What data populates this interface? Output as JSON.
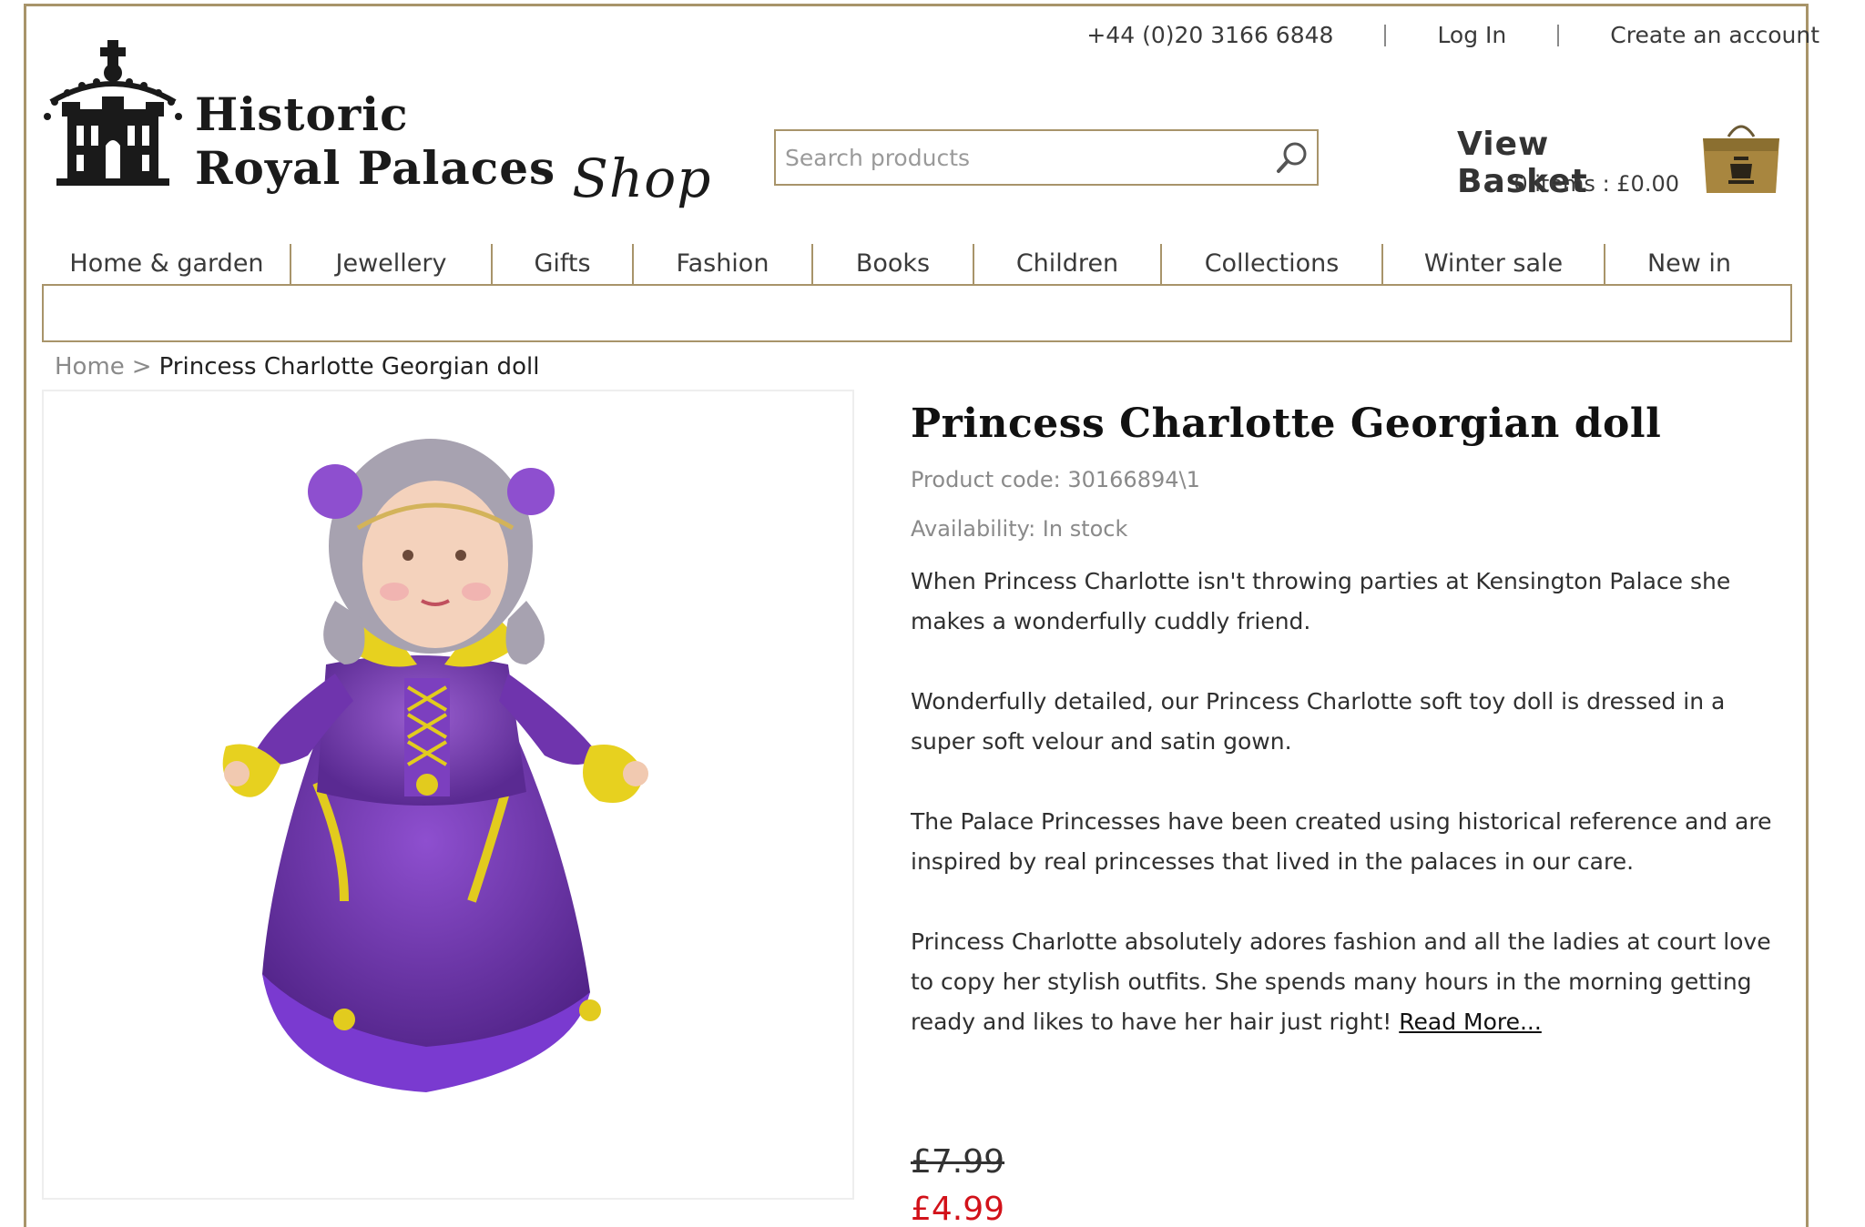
{
  "header": {
    "phone": "+44 (0)20 3166 6848",
    "login": "Log In",
    "create_account": "Create an account",
    "logo_line1": "Historic",
    "logo_line2": "Royal Palaces",
    "logo_shop": "Shop"
  },
  "search": {
    "placeholder": "Search products"
  },
  "basket": {
    "title": "View Basket",
    "summary": "0 items : £0.00"
  },
  "nav": {
    "items": [
      "Home & garden",
      "Jewellery",
      "Gifts",
      "Fashion",
      "Books",
      "Children",
      "Collections",
      "Winter sale",
      "New in"
    ]
  },
  "breadcrumb": {
    "home": "Home",
    "separator": ">",
    "current": "Princess Charlotte Georgian doll"
  },
  "product": {
    "title": "Princess Charlotte Georgian doll",
    "code": "Product code: 30166894\\1",
    "availability": "Availability: In stock",
    "description": [
      "When Princess Charlotte isn't throwing parties at Kensington Palace she makes a wonderfully cuddly friend.",
      "Wonderfully detailed, our Princess Charlotte soft toy doll is dressed in a super soft velour and satin gown.",
      "The Palace Princesses have been created using historical reference and are inspired by real princesses that lived in the palaces in our care.",
      "Princess Charlotte absolutely adores fashion and all the ladies at court love to copy her stylish outfits. She spends many hours in the morning getting ready and likes to have her hair just right!"
    ],
    "read_more": "Read More...",
    "price_old": "£7.99",
    "price_new": "£4.99"
  },
  "icons": {
    "search": "magnifier-icon",
    "basket": "shopping-bag-icon",
    "logo": "crown-tower-crest-icon"
  },
  "colors": {
    "accent_gold": "#a8946a",
    "sale_red": "#d2121a"
  }
}
